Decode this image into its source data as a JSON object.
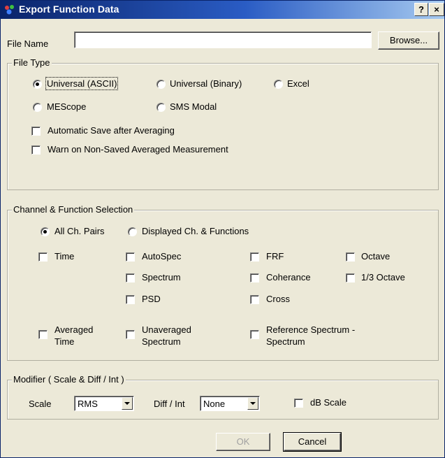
{
  "window": {
    "title": "Export Function Data",
    "help_label": "?",
    "close_label": "×"
  },
  "file": {
    "name_label": "File Name",
    "name_value": "",
    "browse_label": "Browse..."
  },
  "file_type": {
    "title": "File Type",
    "options": [
      {
        "label": "Universal (ASCII)",
        "checked": true
      },
      {
        "label": "Universal (Binary)",
        "checked": false
      },
      {
        "label": "Excel",
        "checked": false
      },
      {
        "label": "MEScope",
        "checked": false
      },
      {
        "label": "SMS Modal",
        "checked": false
      }
    ],
    "auto_save_label": "Automatic Save after Averaging",
    "warn_label": "Warn on Non-Saved Averaged Measurement"
  },
  "channel": {
    "title": "Channel & Function Selection",
    "all_pairs_label": "All Ch. Pairs",
    "displayed_label": "Displayed Ch. & Functions",
    "functions": {
      "time": "Time",
      "autospec": "AutoSpec",
      "spectrum": "Spectrum",
      "psd": "PSD",
      "frf": "FRF",
      "coherance": "Coherance",
      "cross": "Cross",
      "octave": "Octave",
      "third_octave": "1/3 Octave"
    },
    "averaged_time": [
      "Averaged",
      "Time"
    ],
    "unaveraged_spectrum": [
      "Unaveraged",
      "Spectrum"
    ],
    "reference_spectrum": [
      "Reference Spectrum -",
      "Spectrum"
    ]
  },
  "modifier": {
    "title": "Modifier ( Scale & Diff / Int )",
    "scale_label": "Scale",
    "scale_value": "RMS",
    "diff_label": "Diff / Int",
    "diff_value": "None",
    "db_label": "dB Scale"
  },
  "buttons": {
    "ok_label": "OK",
    "cancel_label": "Cancel"
  }
}
